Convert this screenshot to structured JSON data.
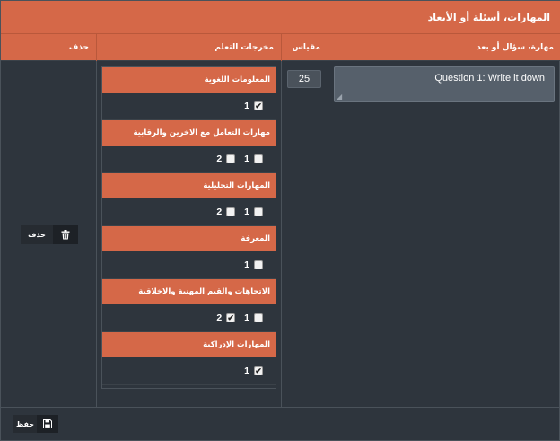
{
  "panel": {
    "title": "المهارات، أسئلة أو الأبعاد"
  },
  "table": {
    "headers": {
      "question": "مهارة، سؤال أو بعد",
      "scale": "مقياس",
      "outcomes": "مخرجات التعلم",
      "delete": "حذف"
    },
    "row": {
      "question_value": "Question 1: Write it down",
      "scale_value": "25",
      "outcome_groups": [
        {
          "title": "المعلومات اللغوية",
          "options": [
            {
              "label": "1",
              "checked": true
            }
          ]
        },
        {
          "title": "مهارات التعامل مع الاخرين والرقابية",
          "options": [
            {
              "label": "1",
              "checked": false
            },
            {
              "label": "2",
              "checked": false
            }
          ]
        },
        {
          "title": "المهارات التحليلية",
          "options": [
            {
              "label": "1",
              "checked": false
            },
            {
              "label": "2",
              "checked": false
            }
          ]
        },
        {
          "title": "المعرفة",
          "options": [
            {
              "label": "1",
              "checked": false
            }
          ]
        },
        {
          "title": "الاتجاهات والقيم المهنية والاخلاقية",
          "options": [
            {
              "label": "1",
              "checked": false
            },
            {
              "label": "2",
              "checked": true
            }
          ]
        },
        {
          "title": "المهارات الإدراكية",
          "options": [
            {
              "label": "1",
              "checked": true
            }
          ]
        }
      ],
      "delete_label": "حذف"
    }
  },
  "footer": {
    "save_label": "حفظ"
  },
  "colors": {
    "accent": "#d56848",
    "background": "#2e353d"
  },
  "icons": {
    "delete": "trash-icon",
    "save": "floppy-disk-icon",
    "checkbox": "checkbox-icon"
  }
}
